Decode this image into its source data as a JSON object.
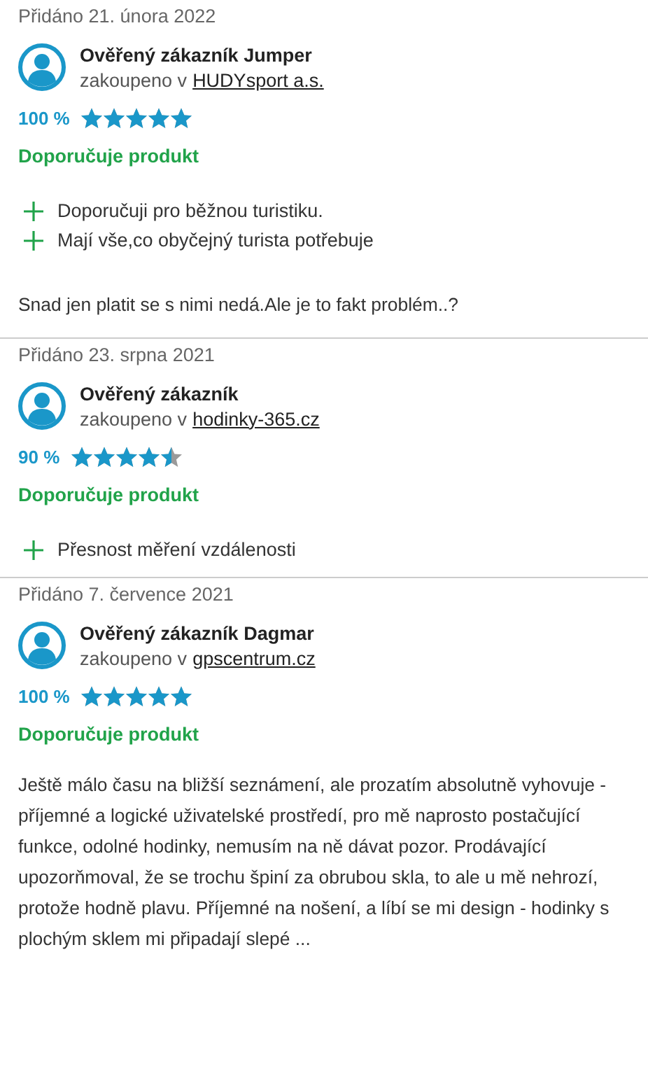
{
  "reviews": [
    {
      "date": "Přidáno 21. února 2022",
      "author": "Ověřený zákazník Jumper",
      "purchased_label": "zakoupeno v",
      "shop": "HUDYsport a.s.",
      "percent": "100 %",
      "stars": 5,
      "recommendation": "Doporučuje produkt",
      "pros": [
        "Doporučuji pro běžnou turistiku.",
        "Mají vše,co obyčejný turista potřebuje"
      ],
      "text": "Snad jen platit se s nimi nedá.Ale je to fakt problém..?"
    },
    {
      "date": "Přidáno 23. srpna 2021",
      "author": "Ověřený zákazník",
      "purchased_label": "zakoupeno v",
      "shop": "hodinky-365.cz",
      "percent": "90 %",
      "stars": 4.5,
      "recommendation": "Doporučuje produkt",
      "pros": [
        "Přesnost měření vzdálenosti"
      ]
    },
    {
      "date": "Přidáno 7. července 2021",
      "author": "Ověřený zákazník Dagmar",
      "purchased_label": "zakoupeno v",
      "shop": "gpscentrum.cz",
      "percent": "100 %",
      "stars": 5,
      "recommendation": "Doporučuje produkt",
      "text": "Ještě málo času na bližší seznámení, ale prozatím absolutně vyhovuje - příjemné a logické uživatelské prostředí, pro mě naprosto postačující funkce, odolné hodinky, nemusím na ně dávat pozor. Prodávající upozorňmoval, že se trochu špiní za obrubou skla, to ale u mě nehrozí, protože hodně plavu. Příjemné na nošení, a líbí se mi design - hodinky s plochým sklem mi připadají slepé ..."
    }
  ]
}
